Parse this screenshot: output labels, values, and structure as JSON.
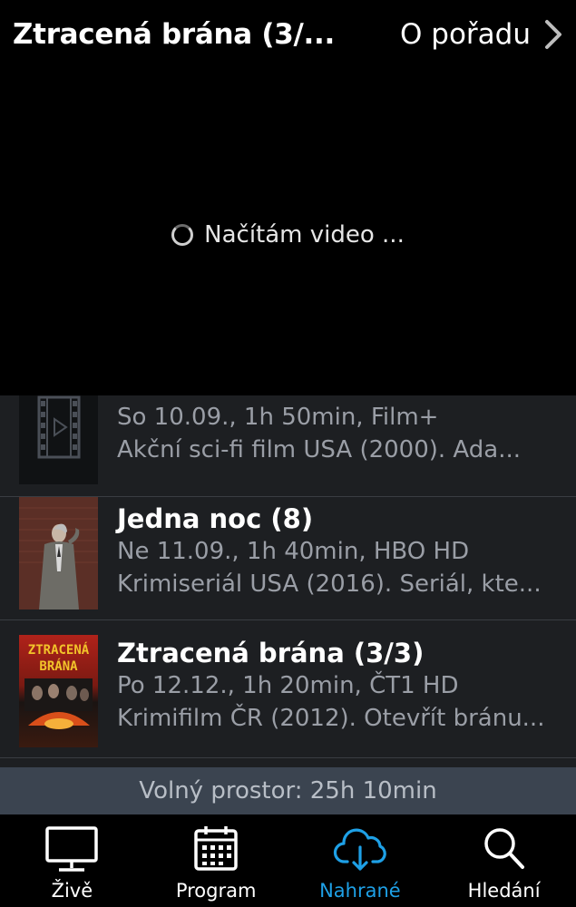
{
  "header": {
    "title": "Ztracená brána (3/...",
    "about_label": "O pořadu"
  },
  "player": {
    "loading_text": "Načítám video ..."
  },
  "recordings": [
    {
      "title": "",
      "meta": "So 10.09., 1h 50min, Film+",
      "description": "Akční sci-fi film USA (2000). Ada..."
    },
    {
      "title": "Jedna noc (8)",
      "meta": "Ne 11.09., 1h 40min, HBO HD",
      "description": "Krimiseriál USA (2016). Seriál, kte..."
    },
    {
      "title": "Ztracená brána (3/3)",
      "meta": "Po 12.12., 1h 20min, ČT1 HD",
      "description": "Krimifilm ČR (2012). Otevřít bránu...",
      "poster_text_line1": "ZTRACENÁ",
      "poster_text_line2": "BRÁNA"
    }
  ],
  "storage": {
    "free_space": "Volný prostor: 25h 10min"
  },
  "nav": {
    "tabs": [
      {
        "label": "Živě",
        "icon": "tv-icon",
        "active": false
      },
      {
        "label": "Program",
        "icon": "calendar-icon",
        "active": false
      },
      {
        "label": "Nahrané",
        "icon": "cloud-download-icon",
        "active": true
      },
      {
        "label": "Hledání",
        "icon": "search-icon",
        "active": false
      }
    ]
  },
  "colors": {
    "accent": "#1ea0e6",
    "list_background": "#1d1f22",
    "storage_bar": "#3b4450",
    "secondary_text": "#9a9ea6"
  }
}
